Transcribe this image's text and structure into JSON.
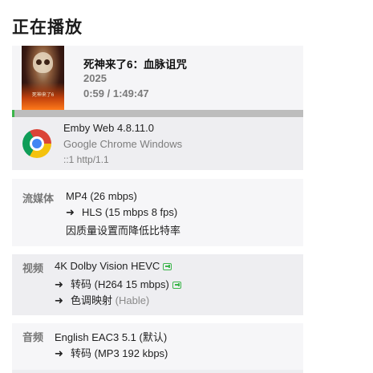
{
  "page": {
    "heading": "正在播放"
  },
  "now_playing": {
    "poster_text": "死神来了6",
    "title": "死神来了6：血脉诅咒",
    "year": "2025",
    "time": "0:59 / 1:49:47",
    "progress_fraction": 0.009,
    "progress_color": "#3bb54a"
  },
  "client": {
    "icon": "chrome-icon",
    "app": "Emby Web 4.8.11.0",
    "browser": "Google Chrome Windows",
    "connection": "::1 http/1.1"
  },
  "streaming": {
    "label": "流媒体",
    "container": "MP4 (26 mbps)",
    "arrow": "➜",
    "hls": "HLS (15 mbps 8 fps)",
    "reason": "因质量设置而降低比特率"
  },
  "video": {
    "label": "视频",
    "source": "4K Dolby Vision HEVC",
    "arrow": "➜",
    "transcode": "转码 (H264 15 mbps)",
    "tonemap": "色调映射",
    "tonemap_mode": "(Hable)",
    "badge_icon": "hardware-acceleration-icon"
  },
  "audio": {
    "label": "音频",
    "source": "English EAC3 5.1 (默认)",
    "arrow": "➜",
    "transcode": "转码 (MP3 192 kbps)"
  }
}
